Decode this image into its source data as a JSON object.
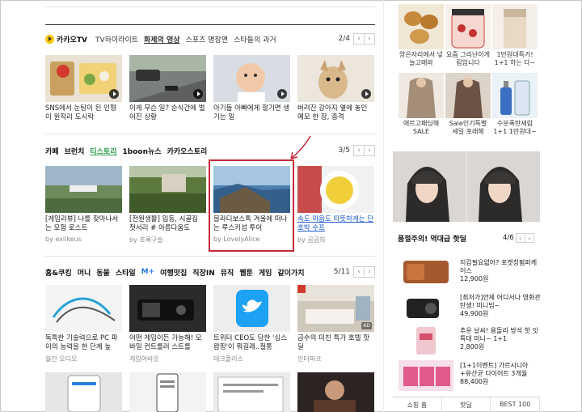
{
  "kakaotv": {
    "brand": "카카오TV",
    "tabs": [
      "TV하이라이트",
      "화제의 영상",
      "스포츠 명장면",
      "스타들의 과거"
    ],
    "page": "2/4",
    "cards": [
      {
        "caption": "SNS에서 눈팅이 된 인형이 원작리 도시락"
      },
      {
        "caption": "이게 무슨 일? 순식간에 벌어진 상황"
      },
      {
        "caption": "아기들 아빠에게 할기면 생기는 일"
      },
      {
        "caption": "버려진 강아지 옆에 놓인 메모 한 장, 충격"
      }
    ]
  },
  "stories": {
    "tabs": [
      "카페",
      "브런치",
      "티스토리",
      "1boon뉴스",
      "카카오스토리"
    ],
    "page": "3/5",
    "cards": [
      {
        "caption": "[게임리뷰] 나를 찾아나서는 모험 로스트",
        "source": "by exlikeus"
      },
      {
        "caption": "[전원생활] 입동, 시골집 첫서리 # 아름다움도",
        "source": "by 초록구슬"
      },
      {
        "caption": "블라디보스톡 겨울에 떠나는 루스키섬 투어",
        "source": "by LovelyAlice"
      },
      {
        "caption": "속도 마음도 따뜻하게는 단호박 수프",
        "source": "by 곰곰희"
      }
    ]
  },
  "homecook": {
    "tabs": [
      "홈&쿠킹",
      "머니",
      "동물",
      "스타일",
      "M+",
      "여행맛집",
      "직장IN",
      "뮤직",
      "웹툰",
      "게임",
      "같이가치"
    ],
    "page": "5/11",
    "ad_label": "AD",
    "cards": [
      {
        "caption": "독특한 기술력으로 PC 파이의 능력을 한 단계 높",
        "source": "월간 오디오"
      },
      {
        "caption": "어떤 게임이든 가능해! 모바일 컨트롤러 스트를",
        "source": "게임어바웃"
      },
      {
        "caption": "트위터 CEO도 당한 '심스왑핑'이 뭐길래..철통",
        "source": "테크플러스"
      },
      {
        "caption": "금수의 미친 특가 호텔 핫딜",
        "source": "인터파크"
      }
    ]
  },
  "shopping": {
    "top": [
      {
        "caption": "앙은자리에서 넣늘고메와"
      },
      {
        "caption": "요즘 그리난이게림입니다"
      },
      {
        "caption": "1만원대특가! 1+1 하는 다~"
      }
    ],
    "middle": [
      {
        "caption": "에르고패딩해 SALE"
      },
      {
        "caption": "Sale인기특별 세일 포래해"
      },
      {
        "caption": "수분폭탄세럼 1+1 1만원대~"
      }
    ],
    "hot_title": "품절주의! 역대급 핫딜",
    "hot_page": "4/6",
    "items": [
      {
        "name": "지갑필요없어? 포켓칭펌퍼케이스",
        "price": "12,900원"
      },
      {
        "name": "[최저가]언제 어디서나 영화관 탄생! 미니빔~",
        "price": "49,900원"
      },
      {
        "name": "추운 날씨! 용돌리 방석 핫 잇 특대 미니~ 1+1",
        "price": "2,800원"
      },
      {
        "name": "[1+1이벤트] 가르시니아 +유산균 다이어트 3개월",
        "price": "88,400원"
      }
    ],
    "bottom_tabs": [
      "쇼핑 홈",
      "핫딜",
      "BEST 100"
    ]
  },
  "colors": {
    "accent_red": "#c7283a",
    "kakao_yellow": "#f7c600",
    "link_blue": "#1a5ad0",
    "green": "#2a9a4a"
  }
}
